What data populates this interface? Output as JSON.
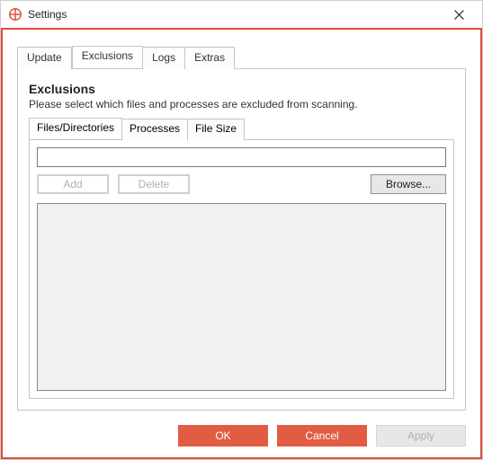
{
  "window": {
    "title": "Settings"
  },
  "tabs": {
    "update": "Update",
    "exclusions": "Exclusions",
    "logs": "Logs",
    "extras": "Extras",
    "active": "exclusions"
  },
  "panel": {
    "heading": "Exclusions",
    "description": "Please select which files and processes are excluded from scanning."
  },
  "subtabs": {
    "files": "Files/Directories",
    "processes": "Processes",
    "filesize": "File Size",
    "active": "files"
  },
  "inputs": {
    "path_value": ""
  },
  "buttons": {
    "add": "Add",
    "delete": "Delete",
    "browse": "Browse...",
    "ok": "OK",
    "cancel": "Cancel",
    "apply": "Apply"
  },
  "colors": {
    "accent": "#e25c44",
    "frame_border": "#e04c3b"
  }
}
